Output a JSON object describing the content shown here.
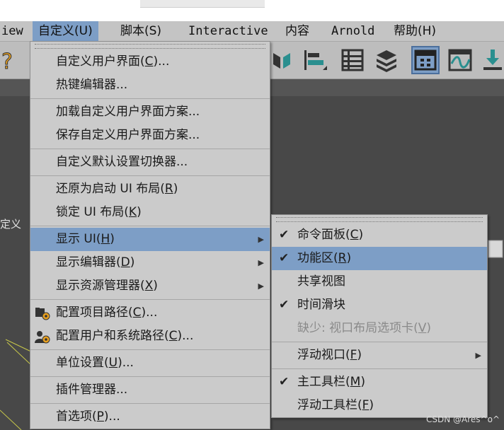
{
  "menubar": {
    "items": [
      {
        "label": "iew"
      },
      {
        "label": "自定义(U)"
      },
      {
        "label": "脚本(S)"
      },
      {
        "label": "Interactive"
      },
      {
        "label": "内容"
      },
      {
        "label": "Arnold"
      },
      {
        "label": "帮助(H)"
      }
    ]
  },
  "viewport": {
    "label": "定义"
  },
  "customize_menu": {
    "items": [
      {
        "label": "自定义用户界面(",
        "key": "C",
        "tail": ")..."
      },
      {
        "label": "热键编辑器..."
      },
      {
        "label": "加载自定义用户界面方案..."
      },
      {
        "label": "保存自定义用户界面方案..."
      },
      {
        "label": "自定义默认设置切换器..."
      },
      {
        "label": "还原为启动 UI 布局(",
        "key": "R",
        "tail": ")"
      },
      {
        "label": "锁定 UI 布局(",
        "key": "K",
        "tail": ")"
      },
      {
        "label": "显示 UI(",
        "key": "H",
        "tail": ")"
      },
      {
        "label": "显示编辑器(",
        "key": "D",
        "tail": ")"
      },
      {
        "label": "显示资源管理器(",
        "key": "X",
        "tail": ")"
      },
      {
        "label": "配置项目路径(",
        "key": "C",
        "tail": ")..."
      },
      {
        "label": "配置用户和系统路径(",
        "key": "C",
        "tail": ")..."
      },
      {
        "label": "单位设置(",
        "key": "U",
        "tail": ")..."
      },
      {
        "label": "插件管理器..."
      },
      {
        "label": "首选项(",
        "key": "P",
        "tail": ")..."
      }
    ]
  },
  "show_ui_submenu": {
    "items": [
      {
        "label": "命令面板(",
        "key": "C",
        "tail": ")"
      },
      {
        "label": "功能区(",
        "key": "R",
        "tail": ")"
      },
      {
        "label": "共享视图"
      },
      {
        "label": "时间滑块"
      },
      {
        "label": "缺少: 视口布局选项卡(",
        "key": "V",
        "tail": ")"
      },
      {
        "label": "浮动视口(",
        "key": "F",
        "tail": ")"
      },
      {
        "label": "主工具栏(",
        "key": "M",
        "tail": ")"
      },
      {
        "label": "浮动工具栏(",
        "key": "F",
        "tail": ")"
      }
    ]
  },
  "watermark": "CSDN @Ares^o^",
  "colors": {
    "highlight": "#7d9ec6",
    "menu_bg": "#cbcbcb",
    "toolbar_bg": "#bdbdbd"
  }
}
